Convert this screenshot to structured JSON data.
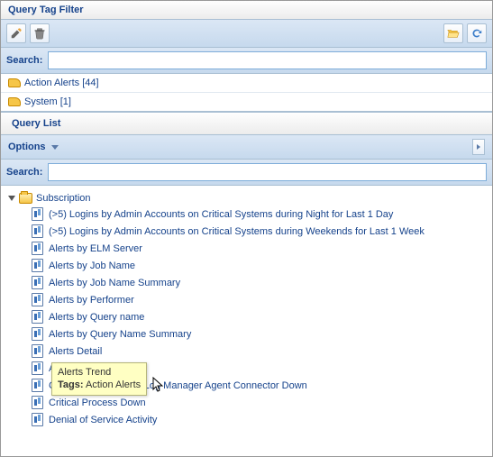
{
  "header": {
    "title": "Query Tag Filter"
  },
  "toolbar": {
    "edit_icon": "pencil",
    "delete_icon": "trash",
    "open_icon": "folder-open",
    "refresh_icon": "refresh"
  },
  "search": {
    "label": "Search:",
    "value": "",
    "placeholder": ""
  },
  "tags": [
    {
      "label": "Action Alerts [44]"
    },
    {
      "label": "System [1]"
    }
  ],
  "query_list_header": "Query List",
  "options": {
    "label": "Options"
  },
  "query_search": {
    "label": "Search:",
    "value": "",
    "placeholder": ""
  },
  "tree": {
    "root_label": "Subscription",
    "items": [
      "(>5) Logins by Admin Accounts on Critical Systems during Night for Last 1 Day",
      "(>5) Logins by Admin Accounts on Critical Systems during Weekends for Last 1 Week",
      "Alerts by ELM Server",
      "Alerts by Job Name",
      "Alerts by Job Name Summary",
      "Alerts by Performer",
      "Alerts by Query name",
      "Alerts by Query Name Summary",
      "Alerts Detail",
      "Alerts Trend",
      "Collection Monitor by Log Manager Agent Connector Down",
      "Critical Process Down",
      "Denial of Service Activity"
    ]
  },
  "tooltip": {
    "title": "Alerts Trend",
    "tags_label": "Tags:",
    "tags_value": "Action Alerts"
  }
}
